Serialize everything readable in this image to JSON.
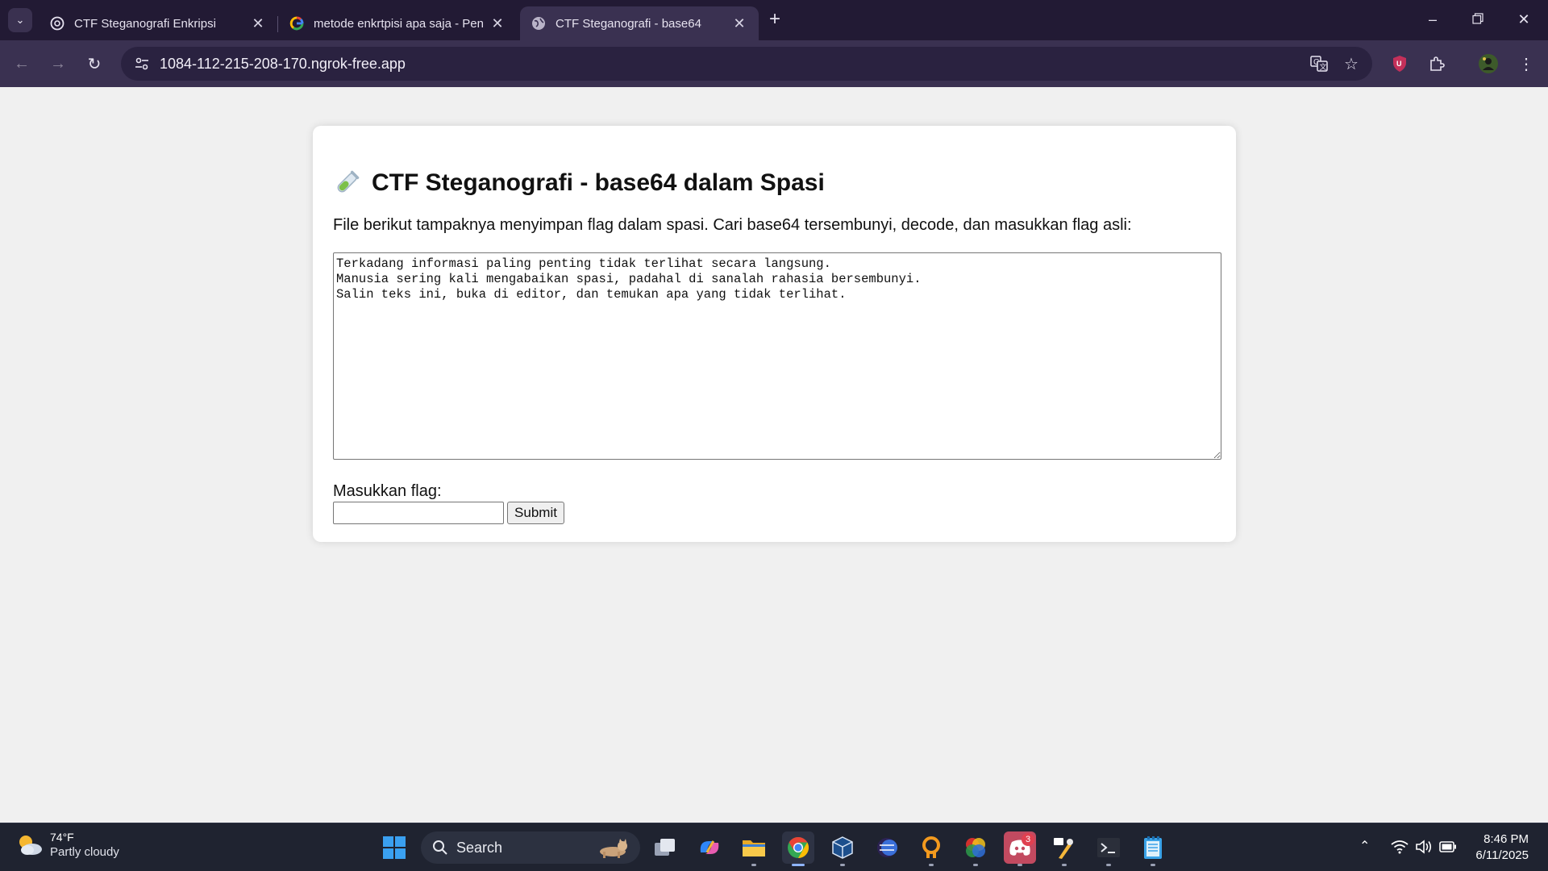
{
  "browser": {
    "tabs": [
      {
        "title": "CTF Steganografi Enkripsi",
        "icon": "chatgpt-icon",
        "active": false
      },
      {
        "title": "metode enkrtpisi apa saja - Pen",
        "icon": "google-icon",
        "active": false
      },
      {
        "title": "CTF Steganografi - base64",
        "icon": "globe-icon",
        "active": true
      }
    ],
    "url": "1084-112-215-208-170.ngrok-free.app"
  },
  "page": {
    "heading": "CTF Steganografi - base64 dalam Spasi",
    "description": "File berikut tampaknya menyimpan flag dalam spasi. Cari base64 tersembunyi, decode, dan masukkan flag asli:",
    "stego_text": "Terkadang informasi paling penting tidak terlihat secara langsung.\nManusia sering kali mengabaikan spasi, padahal di sanalah rahasia bersembunyi.\nSalin teks ini, buka di editor, dan temukan apa yang tidak terlihat.",
    "flag_label": "Masukkan flag:",
    "flag_value": "",
    "submit_label": "Submit"
  },
  "taskbar": {
    "weather_temp": "74°F",
    "weather_condition": "Partly cloudy",
    "search_label": "Search",
    "discord_badge": "3",
    "time": "8:46 PM",
    "date": "6/11/2025"
  },
  "colors": {
    "tabstrip_bg": "#221a34",
    "toolbar_bg": "#3a3151",
    "page_bg": "#f0f0f0",
    "taskbar_bg": "#1f2330"
  }
}
